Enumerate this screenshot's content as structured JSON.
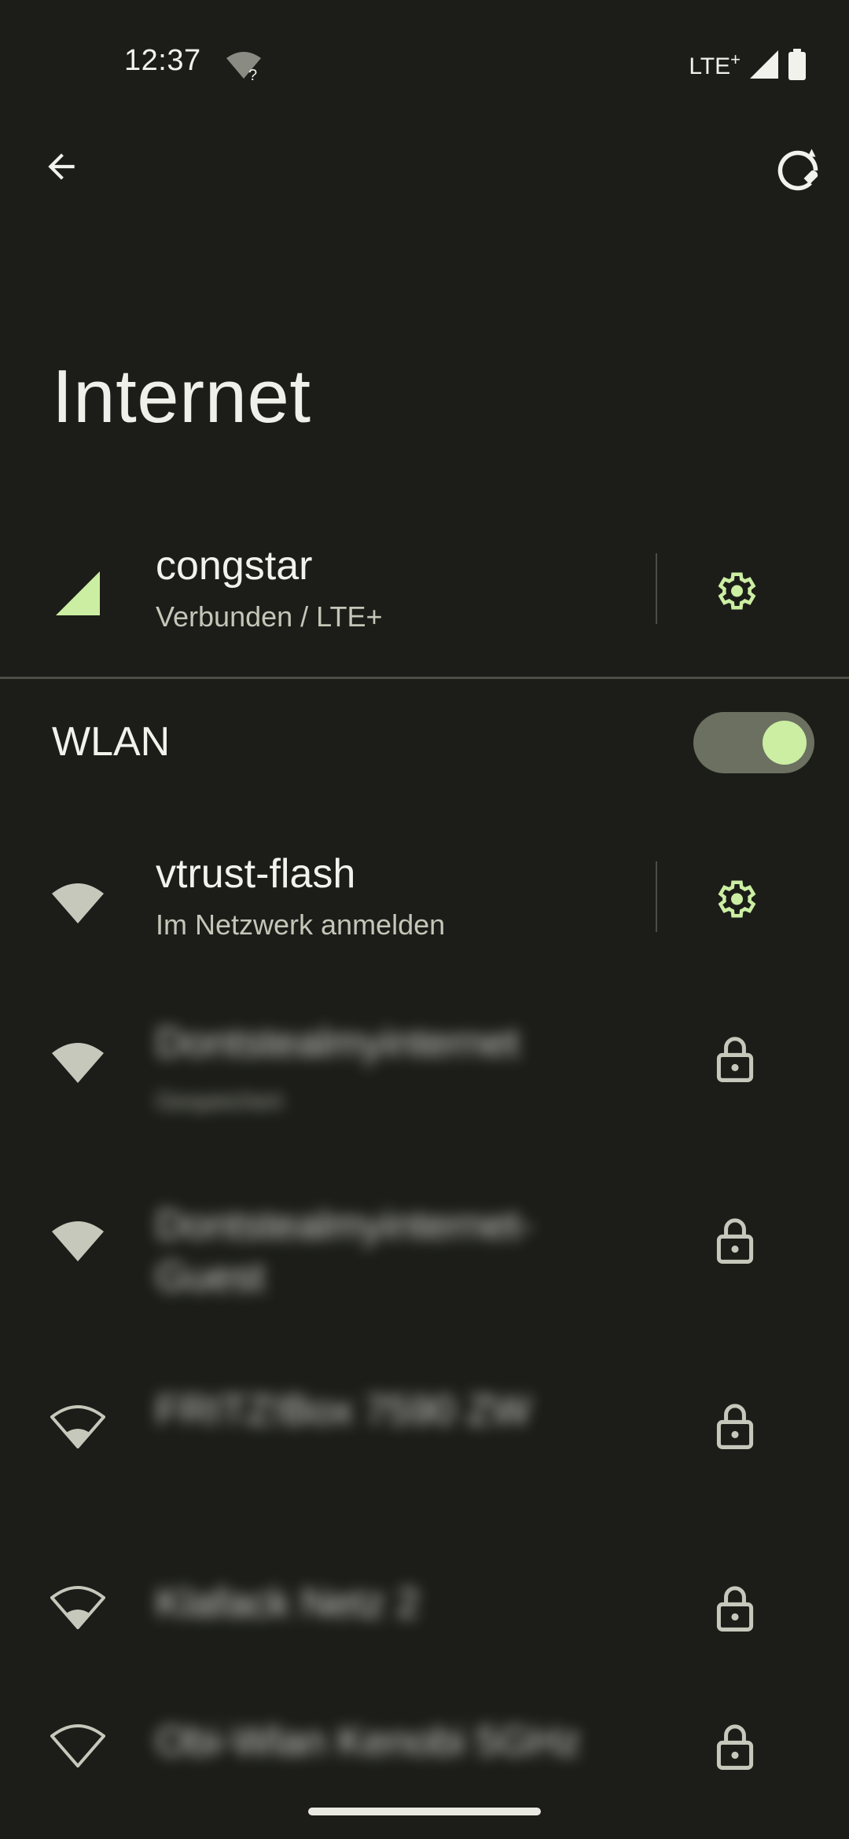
{
  "status_bar": {
    "time": "12:37",
    "network_type": "LTE",
    "network_plus": "+"
  },
  "header": {
    "title": "Internet",
    "back_icon": "arrow-back-icon",
    "repair_icon": "network-reset-icon"
  },
  "mobile": {
    "name": "congstar",
    "status": "Verbunden / LTE+",
    "accent": "#cbeea3"
  },
  "wlan": {
    "label": "WLAN",
    "enabled": true
  },
  "networks": [
    {
      "name": "vtrust-flash",
      "status": "Im Netzwerk anmelden",
      "action": "settings"
    },
    {
      "name": "Dontstealmyinternet",
      "status": "Gespeichert",
      "action": "lock"
    },
    {
      "name": "Dontstealmyinternet-Guest",
      "status": "",
      "action": "lock"
    },
    {
      "name": "FRITZ!Box 7590 ZW",
      "status": "",
      "action": "lock"
    },
    {
      "name": "Klafack Netz 2",
      "status": "",
      "action": "lock"
    },
    {
      "name": "Obi-Wlan Kenobi 5GHz",
      "status": "",
      "action": "lock"
    }
  ]
}
